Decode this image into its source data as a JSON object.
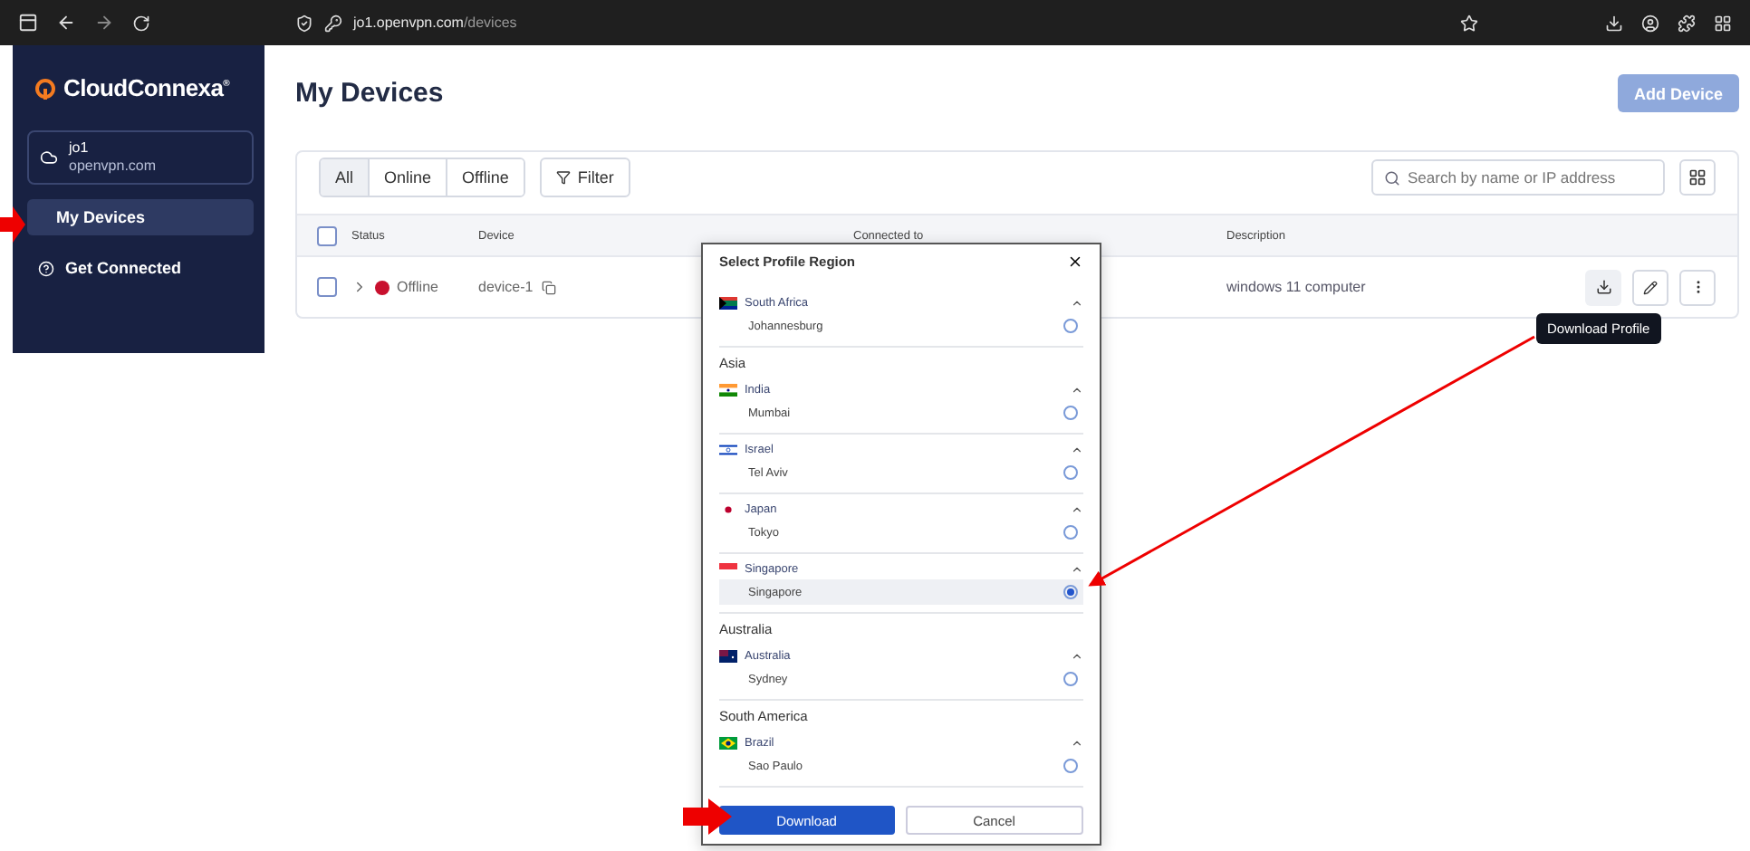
{
  "browser": {
    "url_host": "jo1.openvpn.com",
    "url_path": "/devices"
  },
  "sidebar": {
    "logo": "CloudConnexa$^{®}$",
    "account": {
      "name": "jo1",
      "domain": "openvpn.com"
    },
    "items": [
      {
        "label": "My Devices",
        "selected": true
      },
      {
        "label": "Get Connected",
        "selected": false
      }
    ]
  },
  "page": {
    "title": "My Devices",
    "add_button": "Add Device"
  },
  "filters": {
    "tabs": [
      {
        "label": "All",
        "selected": true
      },
      {
        "label": "Online",
        "selected": false
      },
      {
        "label": "Offline",
        "selected": false
      }
    ],
    "filter_button": "Filter",
    "search": {
      "placeholder": "Search by name or IP address"
    }
  },
  "table": {
    "select_all_checked": false,
    "columns": [
      "Status",
      "Device",
      "Connected to",
      "Description"
    ],
    "rows": [
      {
        "checked": false,
        "status": "Offline",
        "color": "#c8102e",
        "device": "device-1",
        "description": "windows 11 computer"
      }
    ]
  },
  "tooltip": "Download Profile",
  "modal": {
    "title": "Select Profile Region",
    "groups": [
      {
        "countries": [
          {
            "name": "South Africa",
            "kind": "za",
            "cities": [
              {
                "name": "Johannesburg",
                "selected": false
              }
            ]
          }
        ]
      },
      {
        "title": "Asia",
        "countries": [
          {
            "name": "India",
            "kind": "in",
            "cities": [
              {
                "name": "Mumbai",
                "selected": false
              }
            ]
          },
          {
            "name": "Israel",
            "kind": "il",
            "cities": [
              {
                "name": "Tel Aviv",
                "selected": false
              }
            ]
          },
          {
            "name": "Japan",
            "kind": "jp",
            "cities": [
              {
                "name": "Tokyo",
                "selected": false
              }
            ]
          },
          {
            "name": "Singapore",
            "kind": "sg",
            "cities": [
              {
                "name": "Singapore",
                "selected": true
              }
            ]
          }
        ]
      },
      {
        "title": "Australia",
        "countries": [
          {
            "name": "Australia",
            "kind": "au",
            "cities": [
              {
                "name": "Sydney",
                "selected": false
              }
            ]
          }
        ]
      },
      {
        "title": "South America",
        "countries": [
          {
            "name": "Brazil",
            "kind": "br",
            "cities": [
              {
                "name": "Sao Paulo",
                "selected": false
              }
            ]
          }
        ]
      }
    ],
    "primary_button": "Download",
    "secondary_button": "Cancel"
  }
}
